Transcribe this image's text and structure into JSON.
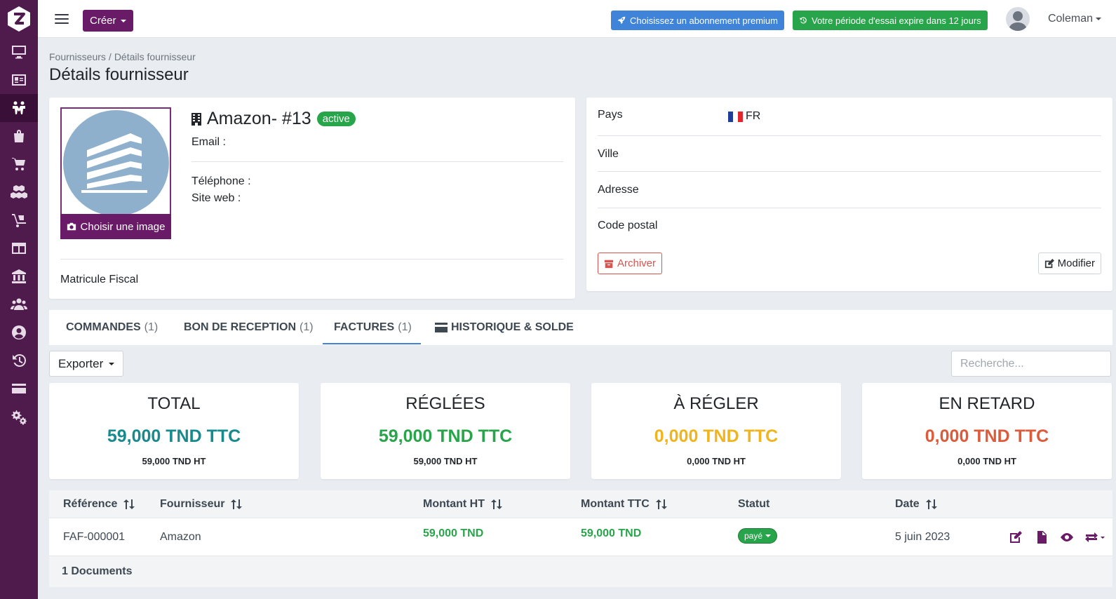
{
  "header": {
    "create_label": "Créer",
    "premium_label": "Choisissez un abonnement premium",
    "trial_label": "Votre période d'essai expire dans 12 jours",
    "user_name": "Coleman"
  },
  "breadcrumb": {
    "parent": "Fournisseurs",
    "separator": "/",
    "current": "Détails fournisseur"
  },
  "page_title": "Détails fournisseur",
  "supplier": {
    "name": "Amazon- #13",
    "status": "active",
    "email_label": "Email :",
    "phone_label": "Téléphone :",
    "website_label": "Site web :",
    "choose_image_label": "Choisir une image",
    "tax_id_label": "Matricule Fiscal"
  },
  "address": {
    "country_label": "Pays",
    "country_value": "FR",
    "city_label": "Ville",
    "address_label": "Adresse",
    "postal_label": "Code postal",
    "archive_label": "Archiver",
    "edit_label": "Modifier"
  },
  "tabs": [
    {
      "label": "COMMANDES",
      "count": "(1)"
    },
    {
      "label": "BON DE RECEPTION",
      "count": "(1)"
    },
    {
      "label": "FACTURES",
      "count": "(1)"
    },
    {
      "label": "HISTORIQUE & SOLDE",
      "count": ""
    }
  ],
  "toolbar": {
    "export_label": "Exporter",
    "search_placeholder": "Recherche..."
  },
  "stats": [
    {
      "title": "TOTAL",
      "value": "59,000 TND TTC",
      "ht": "59,000 TND HT",
      "color": "#178a8e"
    },
    {
      "title": "RÉGLÉES",
      "value": "59,000 TND TTC",
      "ht": "59,000 TND HT",
      "color": "#28a44a"
    },
    {
      "title": "À RÉGLER",
      "value": "0,000 TND TTC",
      "ht": "0,000 TND HT",
      "color": "#f0b51c"
    },
    {
      "title": "EN RETARD",
      "value": "0,000 TND TTC",
      "ht": "0,000 TND HT",
      "color": "#dd5b3a"
    }
  ],
  "table": {
    "columns": [
      "Référence",
      "Fournisseur",
      "Montant HT",
      "Montant TTC",
      "Statut",
      "Date"
    ],
    "rows": [
      {
        "reference": "FAF-000001",
        "supplier": "Amazon",
        "amount_ht": "59,000 TND",
        "amount_ttc": "59,000 TND",
        "status": "payé",
        "date": "5 juin 2023"
      }
    ],
    "footer": "1 Documents"
  },
  "colors": {
    "sidebar": "#4f1b4c",
    "brand": "#6a1b68",
    "primary": "#3f84d8",
    "success": "#28a44a"
  }
}
